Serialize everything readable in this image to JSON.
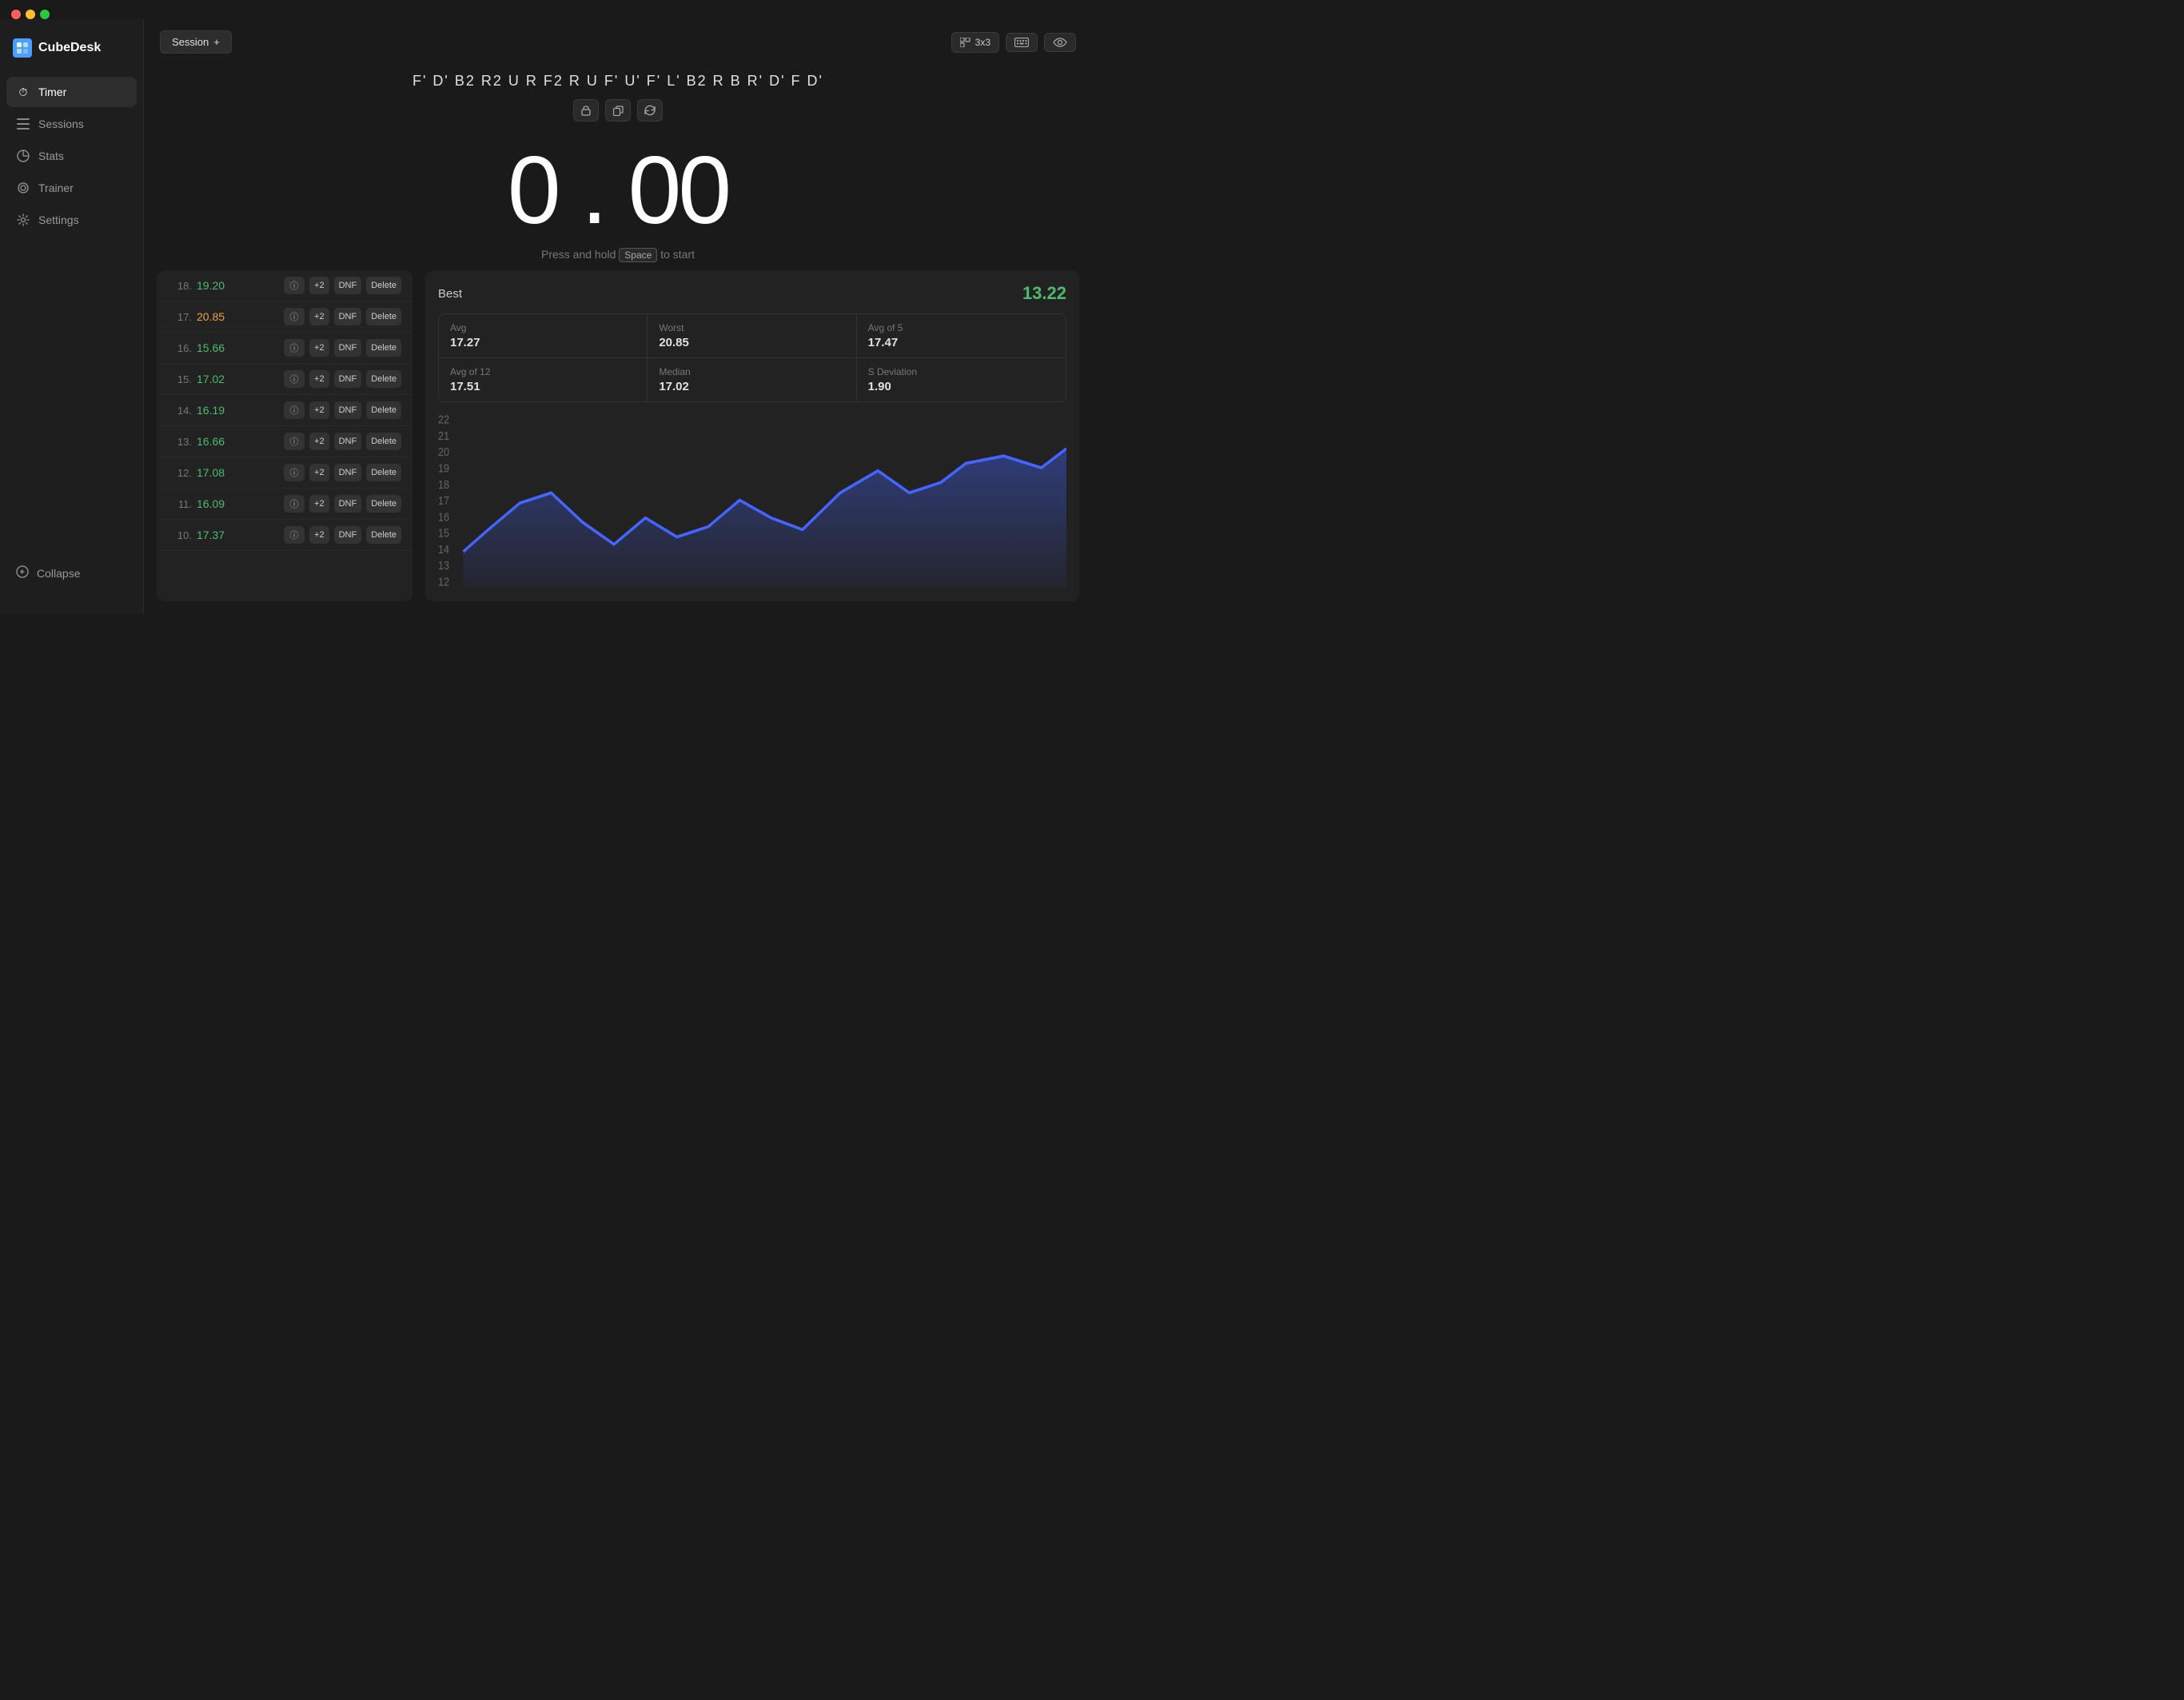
{
  "app": {
    "name": "CubeDesk"
  },
  "window_controls": {
    "close": "close",
    "minimize": "minimize",
    "maximize": "maximize"
  },
  "sidebar": {
    "nav_items": [
      {
        "id": "timer",
        "label": "Timer",
        "icon": "⏱",
        "active": true
      },
      {
        "id": "sessions",
        "label": "Sessions",
        "icon": "≡",
        "active": false
      },
      {
        "id": "stats",
        "label": "Stats",
        "icon": "◑",
        "active": false
      },
      {
        "id": "trainer",
        "label": "Trainer",
        "icon": "◎",
        "active": false
      },
      {
        "id": "settings",
        "label": "Settings",
        "icon": "⚙",
        "active": false
      }
    ],
    "collapse_label": "Collapse"
  },
  "topbar": {
    "session_label": "Session",
    "session_plus": "+",
    "cube_type": "3x3",
    "keyboard_icon": "⌨",
    "eye_icon": "👁"
  },
  "scramble": {
    "text": "F'  D'  B2  R2  U  R  F2  R  U  F'  U'  F'  L'  B2  R  B  R'  D'  F  D'",
    "actions": [
      {
        "id": "lock",
        "icon": "🔒"
      },
      {
        "id": "copy",
        "icon": "⧉"
      },
      {
        "id": "refresh",
        "icon": "↻"
      }
    ]
  },
  "timer": {
    "display": "0 . 00",
    "hint_prefix": "Press and hold",
    "hint_key": "Space",
    "hint_suffix": "to start"
  },
  "solves": [
    {
      "num": "18.",
      "time": "19.20",
      "color": "green"
    },
    {
      "num": "17.",
      "time": "20.85",
      "color": "orange"
    },
    {
      "num": "16.",
      "time": "15.66",
      "color": "green"
    },
    {
      "num": "15.",
      "time": "17.02",
      "color": "green"
    },
    {
      "num": "14.",
      "time": "16.19",
      "color": "green"
    },
    {
      "num": "13.",
      "time": "16.66",
      "color": "green"
    },
    {
      "num": "12.",
      "time": "17.08",
      "color": "green"
    },
    {
      "num": "11.",
      "time": "16.09",
      "color": "green"
    },
    {
      "num": "10.",
      "time": "17.37",
      "color": "green"
    }
  ],
  "solve_buttons": {
    "plus2": "+2",
    "dnf": "DNF",
    "delete": "Delete"
  },
  "stats": {
    "best_label": "Best",
    "best_value": "13.22",
    "cells": [
      {
        "label": "Avg",
        "value": "17.27"
      },
      {
        "label": "Worst",
        "value": "20.85"
      },
      {
        "label": "Avg of 5",
        "value": "17.47"
      },
      {
        "label": "Avg of 12",
        "value": "17.51"
      },
      {
        "label": "Median",
        "value": "17.02"
      },
      {
        "label": "S Deviation",
        "value": "1.90"
      }
    ],
    "chart": {
      "y_labels": [
        "22",
        "21",
        "20",
        "19",
        "18",
        "17",
        "16",
        "15",
        "14",
        "13",
        "12"
      ],
      "color": "#4466ff"
    }
  }
}
